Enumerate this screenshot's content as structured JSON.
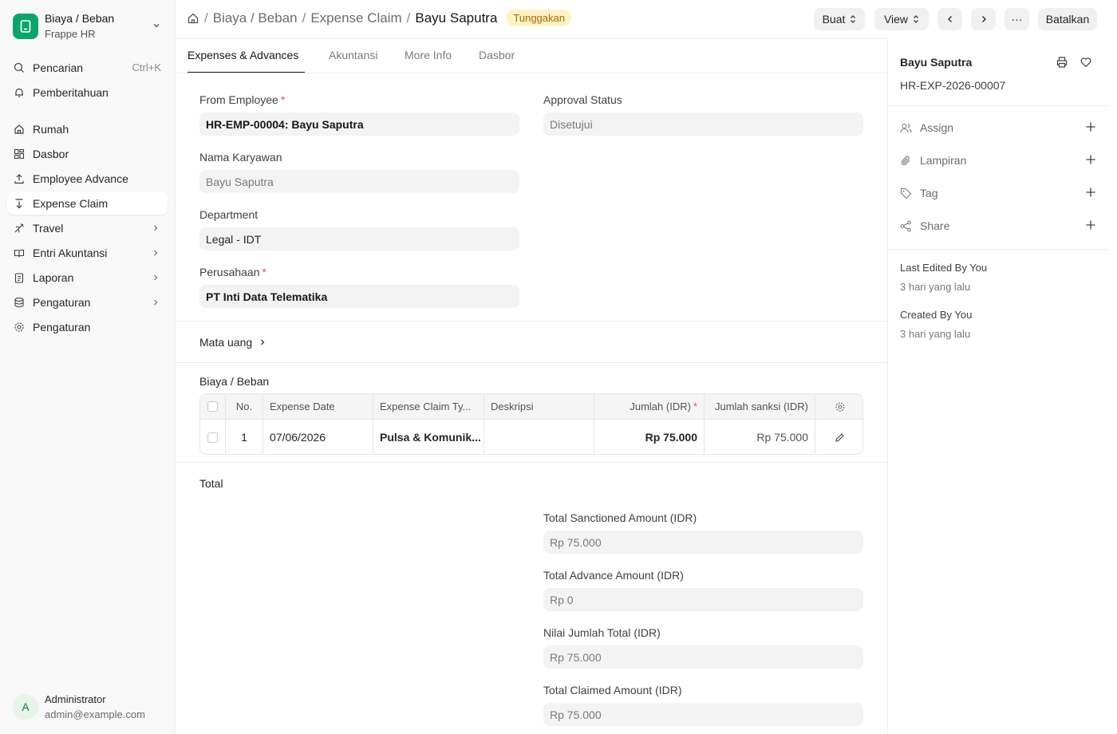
{
  "app": {
    "title": "Biaya / Beban",
    "subtitle": "Frappe HR"
  },
  "sidebar": {
    "search_label": "Pencarian",
    "search_shortcut": "Ctrl+K",
    "notifications_label": "Pemberitahuan",
    "items": [
      {
        "label": "Rumah",
        "icon": "home-icon"
      },
      {
        "label": "Dasbor",
        "icon": "dashboard-icon"
      },
      {
        "label": "Employee Advance",
        "icon": "upload-icon"
      },
      {
        "label": "Expense Claim",
        "icon": "download-icon",
        "active": true
      },
      {
        "label": "Travel",
        "icon": "plane-icon",
        "has_children": true
      },
      {
        "label": "Entri Akuntansi",
        "icon": "ledger-icon",
        "has_children": true
      },
      {
        "label": "Laporan",
        "icon": "report-icon",
        "has_children": true
      },
      {
        "label": "Pengaturan",
        "icon": "database-icon",
        "has_children": true
      },
      {
        "label": "Pengaturan",
        "icon": "gear-icon"
      }
    ],
    "user": {
      "initial": "A",
      "name": "Administrator",
      "email": "admin@example.com"
    }
  },
  "header": {
    "breadcrumbs": [
      "Biaya / Beban",
      "Expense Claim"
    ],
    "current": "Bayu Saputra",
    "status_badge": "Tunggakan",
    "create_label": "Buat",
    "view_label": "View",
    "more_label": "···",
    "cancel_label": "Batalkan"
  },
  "tabs": [
    {
      "label": "Expenses & Advances",
      "active": true
    },
    {
      "label": "Akuntansi"
    },
    {
      "label": "More Info"
    },
    {
      "label": "Dasbor"
    }
  ],
  "form": {
    "from_employee": {
      "label": "From Employee",
      "value": "HR-EMP-00004: Bayu Saputra",
      "required": "*"
    },
    "employee_name": {
      "label": "Nama Karyawan",
      "value": "Bayu Saputra"
    },
    "department": {
      "label": "Department",
      "value": "Legal - IDT"
    },
    "company": {
      "label": "Perusahaan",
      "value": "PT Inti Data Telematika",
      "required": "*"
    },
    "approval_status": {
      "label": "Approval Status",
      "value": "Disetujui"
    },
    "currency_section": "Mata uang",
    "expenses_section": "Biaya / Beban",
    "total_section": "Total"
  },
  "expenses_table": {
    "columns": [
      "No.",
      "Expense Date",
      "Expense Claim Ty...",
      "Deskripsi",
      "Jumlah (IDR)",
      "Jumlah sanksi (IDR)"
    ],
    "required_mark": "*",
    "rows": [
      {
        "no": "1",
        "date": "07/06/2026",
        "type": "Pulsa & Komunik...",
        "description": "",
        "amount": "Rp 75.000",
        "sanctioned": "Rp 75.000"
      }
    ]
  },
  "totals": {
    "sanctioned": {
      "label": "Total Sanctioned Amount (IDR)",
      "value": "Rp 75.000"
    },
    "advance": {
      "label": "Total Advance Amount (IDR)",
      "value": "Rp 0"
    },
    "grand": {
      "label": "Nilai Jumlah Total (IDR)",
      "value": "Rp 75.000"
    },
    "claimed": {
      "label": "Total Claimed Amount (IDR)",
      "value": "Rp 75.000"
    }
  },
  "side_panel": {
    "title": "Bayu Saputra",
    "doc_id": "HR-EXP-2026-00007",
    "assign_label": "Assign",
    "attachments_label": "Lampiran",
    "tags_label": "Tag",
    "share_label": "Share",
    "last_edited": "Last Edited By You",
    "last_edited_time": "3 hari yang lalu",
    "created": "Created By You",
    "created_time": "3 hari yang lalu"
  }
}
